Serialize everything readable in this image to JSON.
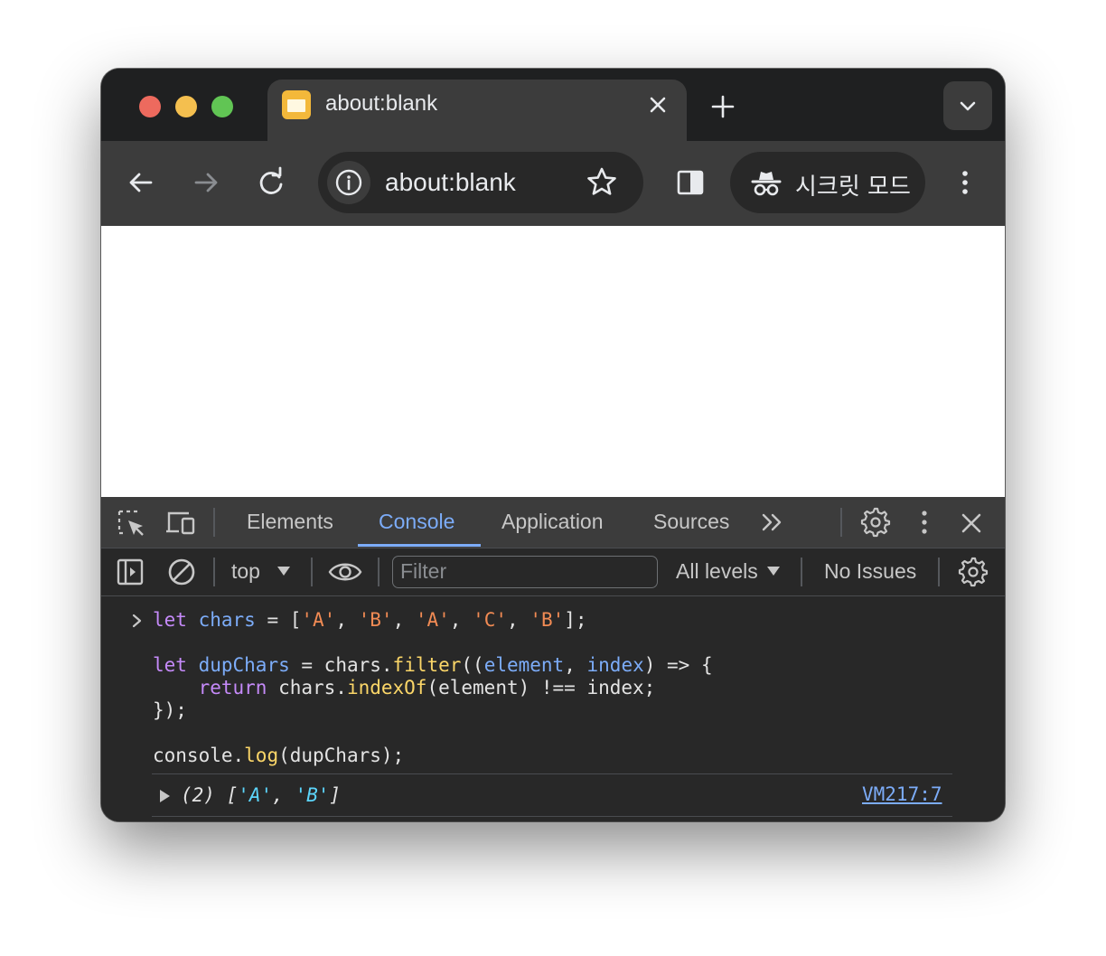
{
  "tab": {
    "title": "about:blank",
    "close_label": "×"
  },
  "omnibox": {
    "url": "about:blank"
  },
  "incognito": {
    "label": "시크릿 모드"
  },
  "devtools": {
    "tabs": [
      "Elements",
      "Console",
      "Application",
      "Sources"
    ],
    "active_tab": "Console",
    "context": "top",
    "filter_placeholder": "Filter",
    "levels": "All levels",
    "issues": "No Issues"
  },
  "console": {
    "source_link": "VM217:7"
  },
  "colors": {
    "keyword": "#c58af9",
    "variable": "#7cacf8",
    "string": "#f28b54",
    "function": "#fbd668",
    "result_string": "#5cd5fb"
  }
}
